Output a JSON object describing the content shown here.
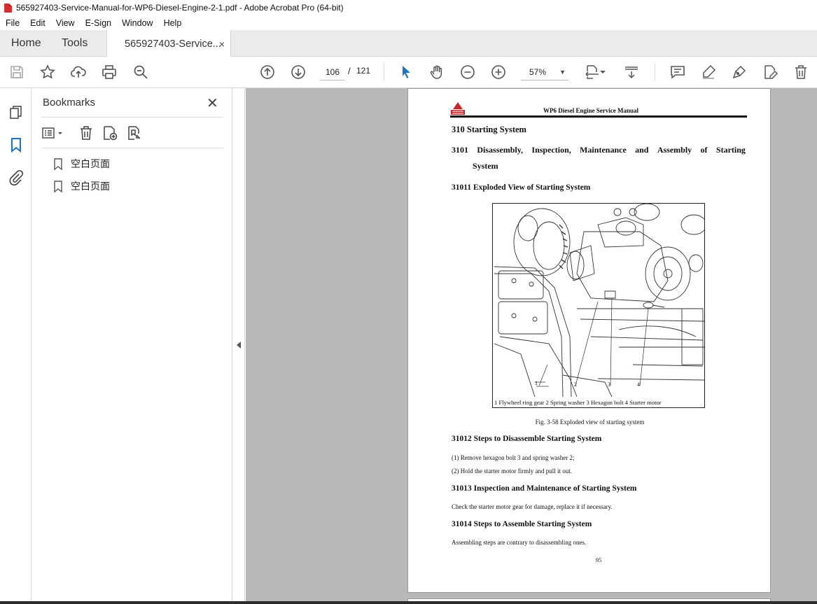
{
  "window": {
    "title": "565927403-Service-Manual-for-WP6-Diesel-Engine-2-1.pdf - Adobe Acrobat Pro (64-bit)"
  },
  "menu": [
    "File",
    "Edit",
    "View",
    "E-Sign",
    "Window",
    "Help"
  ],
  "tabs": {
    "home": "Home",
    "tools": "Tools",
    "document": "565927403-Service...",
    "close": "×"
  },
  "toolbar": {
    "current_page": "106",
    "page_separator": "/",
    "total_pages": "121",
    "zoom": "57%"
  },
  "bookmarks": {
    "title": "Bookmarks",
    "close": "✕",
    "items": [
      "空白页面",
      "空白页面"
    ]
  },
  "document": {
    "header_title": "WP6 Diesel Engine Service Manual",
    "section": "310 Starting System",
    "subsection_words": [
      "3101",
      "Disassembly,",
      "Inspection,",
      "Maintenance",
      "and",
      "Assembly",
      "of",
      "Starting"
    ],
    "subsection_cont": "System",
    "exploded_heading": "31011 Exploded View of Starting System",
    "figure_labels": "1 Flywheel ring gear   2 Spring washer  3 Hexagon bolt  4 Starter motor",
    "callouts": [
      "1",
      "2",
      "3",
      "4"
    ],
    "figure_caption": "Fig. 3-58 Exploded view of starting system",
    "disassemble_heading": "31012 Steps to Disassemble Starting System",
    "disassemble_steps": [
      "(1)   Remove hexagon bolt 3 and spring washer 2;",
      "(2)   Hold the starter motor firmly and pull it out."
    ],
    "inspection_heading": "31013 Inspection and Maintenance of Starting System",
    "inspection_text": "Check the starter motor gear for damage, replace it if necessary.",
    "assemble_heading": "31014 Steps to Assemble Starting System",
    "assemble_text": "Assembling steps are contrary to disassembling ones.",
    "page_number": "95"
  },
  "colors": {
    "accent_blue": "#1a73c9",
    "tab_bar": "#ebebeb",
    "viewer_bg": "#b8b8b8",
    "logo_red": "#c62828"
  }
}
